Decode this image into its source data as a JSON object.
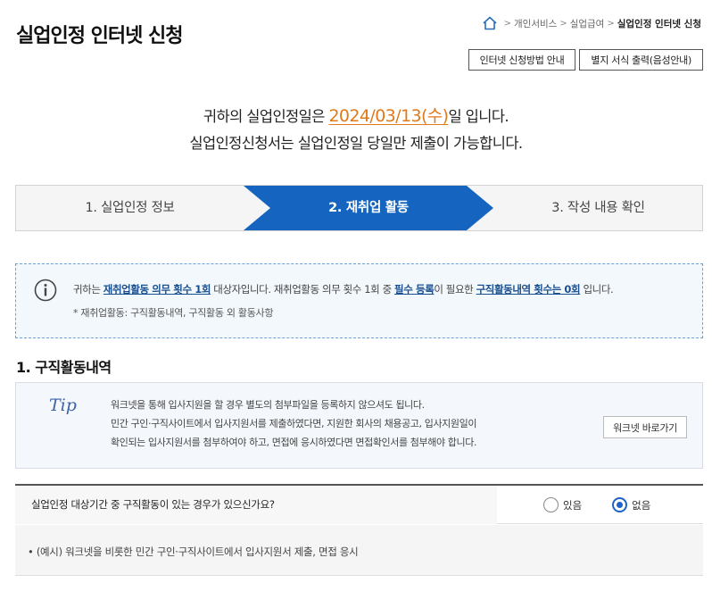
{
  "page_title": "실업인정 인터넷 신청",
  "breadcrumb": {
    "items": [
      "개인서비스",
      "실업급여"
    ],
    "current": "실업인정 인터넷 신청"
  },
  "top_buttons": {
    "guide": "인터넷 신청방법 안내",
    "print": "별지 서식 출력(음성안내)"
  },
  "notice": {
    "line1_prefix": "귀하의 실업인정일은 ",
    "date": "2024/03/13(수)",
    "line1_suffix": "일 입니다.",
    "line2": "실업인정신청서는 실업인정일 당일만 제출이 가능합니다."
  },
  "steps": [
    {
      "label": "1. 실업인정 정보",
      "active": false
    },
    {
      "label": "2. 재취업 활동",
      "active": true
    },
    {
      "label": "3. 작성 내용 확인",
      "active": false
    }
  ],
  "info": {
    "p1": "귀하는 ",
    "h1": "재취업활동 의무 횟수 1회",
    "p2": " 대상자입니다. 재취업활동 의무 횟수 1회 중 ",
    "h2": "필수 등록",
    "p3": "이 필요한 ",
    "h3": "구직활동내역 횟수는 0회",
    "p4": " 입니다.",
    "note": "* 재취업활동: 구직활동내역, 구직활동 외 활동사항"
  },
  "section_title": "1. 구직활동내역",
  "tip": {
    "label": "Tip",
    "lines": [
      "워크넷을 통해 입사지원을 할 경우 별도의 첨부파일을 등록하지 않으셔도 됩니다.",
      "민간 구인·구직사이트에서 입사지원서를 제출하였다면, 지원한 회사의 채용공고, 입사지원일이",
      "확인되는 입사지원서를 첨부하여야 하고, 면접에 응시하였다면 면접확인서를 첨부해야 합니다."
    ],
    "button": "워크넷 바로가기"
  },
  "question": {
    "label": "실업인정 대상기간 중 구직활동이 있는 경우가 있으신가요?",
    "options": [
      {
        "label": "있음",
        "checked": false
      },
      {
        "label": "없음",
        "checked": true
      }
    ]
  },
  "example": {
    "bullet": "•",
    "prefix": "(예시)",
    "text": " 워크넷을 비롯한 민간 구인·구직사이트에서 입사지원서 제출, 면접 응시"
  },
  "colors": {
    "step_active": "#1565c0",
    "date_accent": "#e07a1a",
    "highlight_text": "#1a4f8f",
    "radio_checked": "#1f63c6"
  }
}
